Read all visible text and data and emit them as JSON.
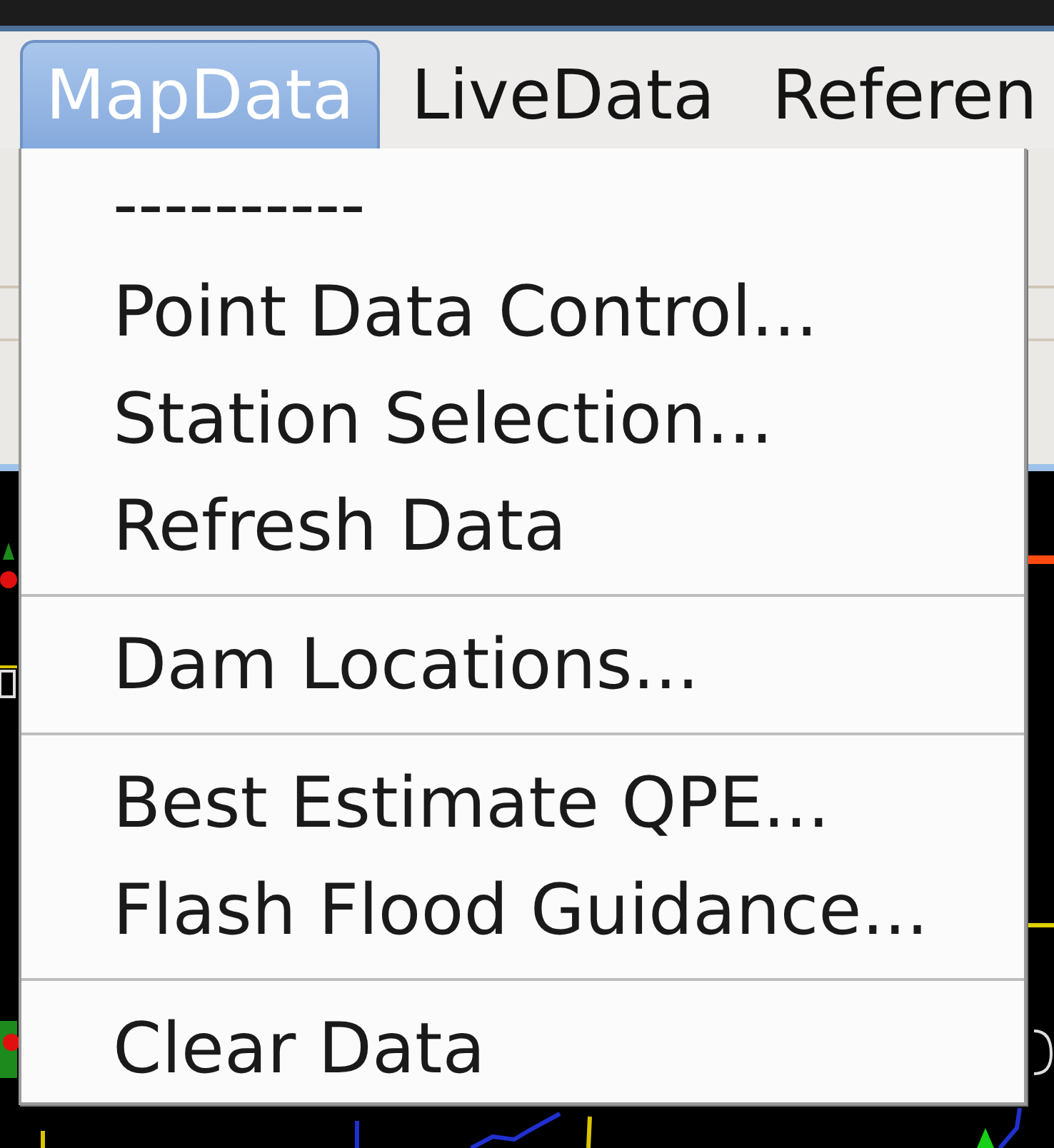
{
  "menubar": {
    "menus": [
      {
        "label": "MapData",
        "selected": true
      },
      {
        "label": "LiveData",
        "selected": false
      },
      {
        "label": "Referen",
        "selected": false
      }
    ]
  },
  "dropdown": {
    "items": [
      {
        "kind": "item",
        "label": "----------"
      },
      {
        "kind": "item",
        "label": "Point Data Control..."
      },
      {
        "kind": "item",
        "label": "Station Selection..."
      },
      {
        "kind": "item",
        "label": "Refresh Data"
      },
      {
        "kind": "separator"
      },
      {
        "kind": "item",
        "label": "Dam Locations..."
      },
      {
        "kind": "separator"
      },
      {
        "kind": "item",
        "label": "Best Estimate QPE..."
      },
      {
        "kind": "item",
        "label": "Flash Flood Guidance..."
      },
      {
        "kind": "separator"
      },
      {
        "kind": "item",
        "label": "Clear Data"
      }
    ]
  }
}
